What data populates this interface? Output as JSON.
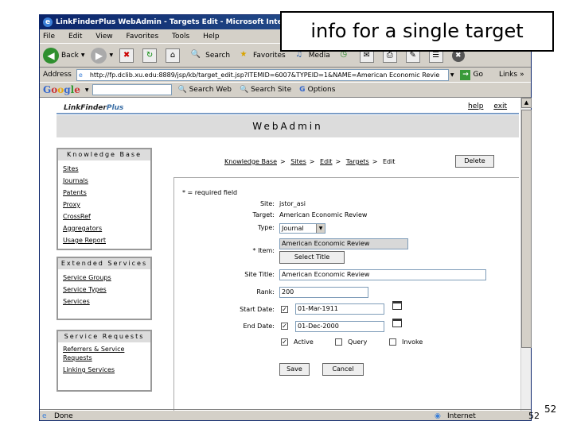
{
  "callout": {
    "text": "info for a single target"
  },
  "slide_number": "52",
  "slide_number_overlap": "52",
  "browser": {
    "title": "LinkFinderPlus WebAdmin - Targets Edit - Microsoft Internet Explorer",
    "menu": [
      "File",
      "Edit",
      "View",
      "Favorites",
      "Tools",
      "Help"
    ],
    "toolbar": {
      "back": "Back",
      "search": "Search",
      "favorites": "Favorites",
      "media": "Media"
    },
    "address_label": "Address",
    "address": "http://fp.dclib.xu.edu:8889/jsp/kb/target_edit.jsp?ITEMID=6007&TYPEID=1&NAME=American Economic Revie",
    "go": "Go",
    "links": "Links",
    "google": {
      "logo": "Google",
      "search_web": "Search Web",
      "search_site": "Search Site",
      "options": "Options"
    },
    "status": "Done",
    "zone": "Internet"
  },
  "page": {
    "logo": "LinkFinder",
    "logo_plus": "Plus",
    "help": "help",
    "exit": "exit",
    "banner": "WebAdmin",
    "knowledge_base": {
      "title": "Knowledge Base",
      "items": [
        "Sites",
        "Journals",
        "Patents",
        "Proxy",
        "CrossRef",
        "Aggregators",
        "Usage Report"
      ]
    },
    "extended_services": {
      "title": "Extended Services",
      "items": [
        "Service Groups",
        "Service Types",
        "Services"
      ]
    },
    "service_requests": {
      "title": "Service Requests",
      "items": [
        "Referrers & Service Requests",
        "Linking Services"
      ]
    },
    "breadcrumb": [
      "Knowledge Base",
      "Sites",
      "Edit",
      "Targets",
      "Edit"
    ],
    "delete": "Delete",
    "form": {
      "required_note": "* = required field",
      "site_label": "Site:",
      "site_value": "jstor_asi",
      "target_label": "Target:",
      "target_value": "American Economic Review",
      "type_label": "Type:",
      "type_value": "Journal",
      "item_label": "* Item:",
      "item_value": "American Economic Review",
      "select_title": "Select Title",
      "site_title_label": "Site Title:",
      "site_title_value": "American Economic Review",
      "rank_label": "Rank:",
      "rank_value": "200",
      "start_date_label": "Start Date:",
      "start_date_value": "01-Mar-1911",
      "end_date_label": "End Date:",
      "end_date_value": "01-Dec-2000",
      "active": "Active",
      "query": "Query",
      "invoke": "Invoke",
      "save": "Save",
      "cancel": "Cancel"
    }
  }
}
